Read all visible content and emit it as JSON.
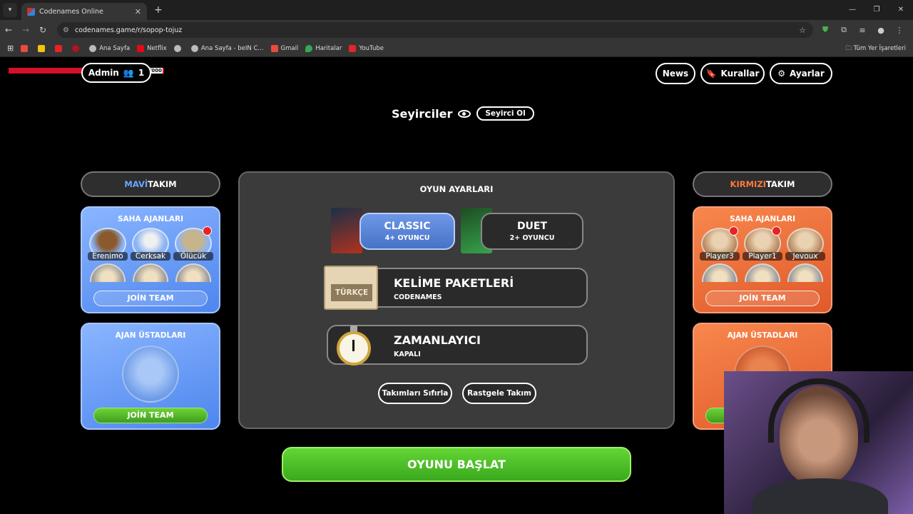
{
  "browser": {
    "tab_title": "Codenames Online",
    "url": "codenames.game/r/sopop-tojuz",
    "bookmarks": [
      "Ana Sayfa",
      "Netflix",
      "Ana Sayfa - beIN C...",
      "Gmail",
      "Haritalar",
      "YouTube"
    ],
    "all_bookmarks": "Tüm Yer İşaretleri"
  },
  "header": {
    "admin_label": "Admin",
    "admin_count": "1",
    "news": "News",
    "rules": "Kurallar",
    "settings": "Ayarlar",
    "banner_tag": "RYT000"
  },
  "spectators": {
    "title": "Seyirciler",
    "button": "Seyirci Ol"
  },
  "blue_team": {
    "title_color": "MAVİ",
    "title_rest": " TAKIM",
    "operatives_title": "SAHA AJANLARI",
    "players": [
      "Erenimo",
      "Cerksak",
      "Ölücük"
    ],
    "join": "JOİN TEAM",
    "spymaster_title": "AJAN ÜSTADLARI",
    "spymaster_join": "JOİN TEAM"
  },
  "red_team": {
    "title_color": "KIRMIZI",
    "title_rest": " TAKIM",
    "operatives_title": "SAHA AJANLARI",
    "players": [
      "Player3",
      "Player1",
      "Jevoux"
    ],
    "join": "JOİN TEAM",
    "spymaster_title": "AJAN ÜSTADLARI"
  },
  "settings_panel": {
    "title": "OYUN AYARLARI",
    "classic": {
      "name": "CLASSIC",
      "players": "4+ OYUNCU"
    },
    "duet": {
      "name": "DUET",
      "players": "2+ OYUNCU"
    },
    "words": {
      "title": "KELİME PAKETLERİ",
      "value": "CODENAMES",
      "card": "TÜRKÇE"
    },
    "timer": {
      "title": "ZAMANLAYICI",
      "value": "KAPALI"
    },
    "reset_teams": "Takımları Sıfırla",
    "random_team": "Rastgele Takım"
  },
  "start_button": "OYUNU BAŞLAT"
}
